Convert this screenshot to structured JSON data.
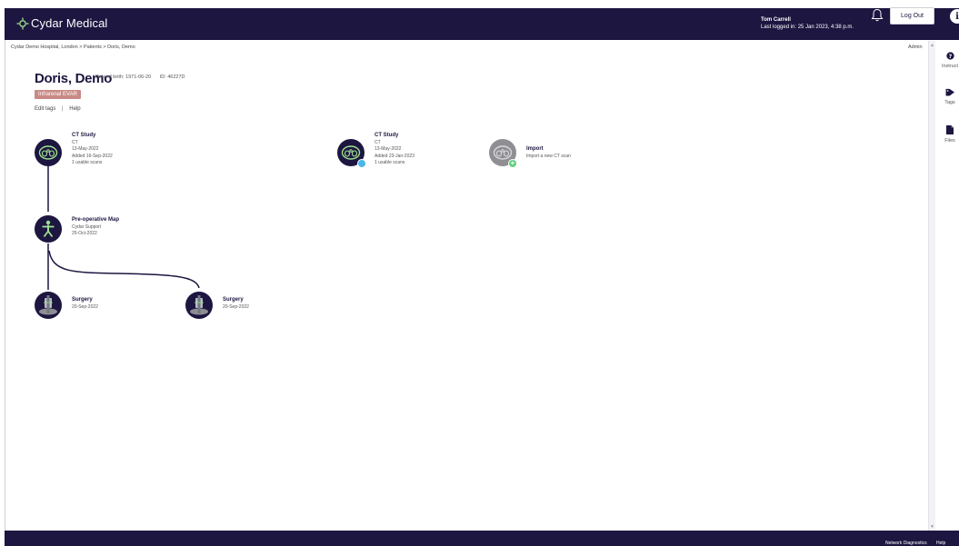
{
  "header": {
    "brand": "Cydar Medical",
    "user_name": "Tom Carrell",
    "last_login": "Last logged in: 25 Jan 2023, 4:38 p.m.",
    "logout_label": "Log Out",
    "info_label": "i"
  },
  "breadcrumb": "Cydar Demo Hospital, London > Patients > Doris, Demo",
  "admin_label": "Admin",
  "patient": {
    "name": "Doris, Demo",
    "dob": "Date of birth: 1971-06-20",
    "id": "ID: 46227D",
    "tag": "Infrarenal EVAR",
    "edit_tags": "Edit tags",
    "help": "Help"
  },
  "rail": {
    "instructions": "Instruct",
    "tags": "Tags",
    "files": "Files"
  },
  "nodes": {
    "ct1": {
      "title": "CT Study",
      "lines": [
        "CT",
        "13-May-2022",
        "Added 16-Sep-2022",
        "1 usable scans"
      ]
    },
    "ct2": {
      "title": "CT Study",
      "lines": [
        "CT",
        "13-May-2022",
        "Added 23-Jan-2023",
        "1 usable scans"
      ]
    },
    "import": {
      "title": "Import",
      "lines": [
        "Import a new CT scan"
      ]
    },
    "map": {
      "title": "Pre-operative Map",
      "lines": [
        "Cydar Support",
        "25-Oct-2022"
      ]
    },
    "surgery1": {
      "title": "Surgery",
      "lines": [
        "20-Sep-2022"
      ]
    },
    "surgery2": {
      "title": "Surgery",
      "lines": [
        "20-Sep-2022"
      ]
    }
  },
  "footer": {
    "network": "Network Diagnostics",
    "help": "Help"
  },
  "colors": {
    "navy": "#1c1640",
    "tag": "#c98a86",
    "kidney_green": "#9fe08f",
    "badge_blue": "#4ab8e8",
    "badge_green": "#5fd07a"
  },
  "icons": [
    "cydar-logo-icon",
    "bell-icon",
    "info-icon",
    "question-circle-icon",
    "tag-icon",
    "file-icon",
    "kidney-scan-icon",
    "person-map-icon",
    "surgery-icon",
    "plus-badge-icon"
  ]
}
